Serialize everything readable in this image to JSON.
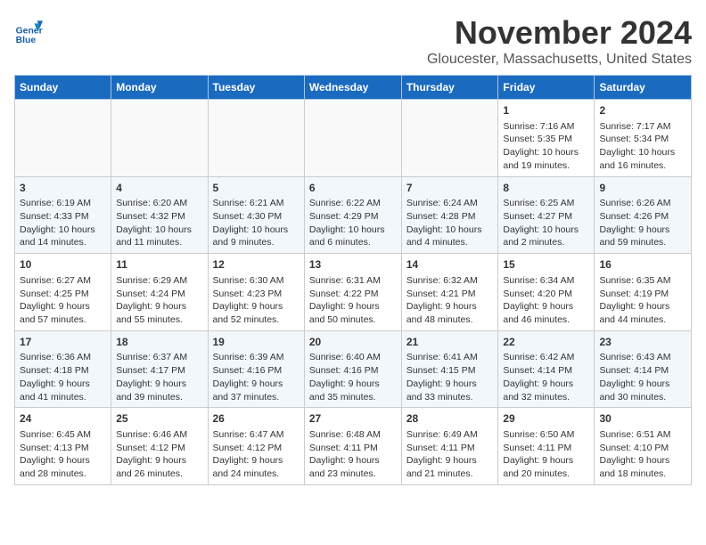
{
  "logo": {
    "line1": "General",
    "line2": "Blue"
  },
  "title": "November 2024",
  "subtitle": "Gloucester, Massachusetts, United States",
  "days_of_week": [
    "Sunday",
    "Monday",
    "Tuesday",
    "Wednesday",
    "Thursday",
    "Friday",
    "Saturday"
  ],
  "weeks": [
    [
      {
        "day": "",
        "info": ""
      },
      {
        "day": "",
        "info": ""
      },
      {
        "day": "",
        "info": ""
      },
      {
        "day": "",
        "info": ""
      },
      {
        "day": "",
        "info": ""
      },
      {
        "day": "1",
        "info": "Sunrise: 7:16 AM\nSunset: 5:35 PM\nDaylight: 10 hours and 19 minutes."
      },
      {
        "day": "2",
        "info": "Sunrise: 7:17 AM\nSunset: 5:34 PM\nDaylight: 10 hours and 16 minutes."
      }
    ],
    [
      {
        "day": "3",
        "info": "Sunrise: 6:19 AM\nSunset: 4:33 PM\nDaylight: 10 hours and 14 minutes."
      },
      {
        "day": "4",
        "info": "Sunrise: 6:20 AM\nSunset: 4:32 PM\nDaylight: 10 hours and 11 minutes."
      },
      {
        "day": "5",
        "info": "Sunrise: 6:21 AM\nSunset: 4:30 PM\nDaylight: 10 hours and 9 minutes."
      },
      {
        "day": "6",
        "info": "Sunrise: 6:22 AM\nSunset: 4:29 PM\nDaylight: 10 hours and 6 minutes."
      },
      {
        "day": "7",
        "info": "Sunrise: 6:24 AM\nSunset: 4:28 PM\nDaylight: 10 hours and 4 minutes."
      },
      {
        "day": "8",
        "info": "Sunrise: 6:25 AM\nSunset: 4:27 PM\nDaylight: 10 hours and 2 minutes."
      },
      {
        "day": "9",
        "info": "Sunrise: 6:26 AM\nSunset: 4:26 PM\nDaylight: 9 hours and 59 minutes."
      }
    ],
    [
      {
        "day": "10",
        "info": "Sunrise: 6:27 AM\nSunset: 4:25 PM\nDaylight: 9 hours and 57 minutes."
      },
      {
        "day": "11",
        "info": "Sunrise: 6:29 AM\nSunset: 4:24 PM\nDaylight: 9 hours and 55 minutes."
      },
      {
        "day": "12",
        "info": "Sunrise: 6:30 AM\nSunset: 4:23 PM\nDaylight: 9 hours and 52 minutes."
      },
      {
        "day": "13",
        "info": "Sunrise: 6:31 AM\nSunset: 4:22 PM\nDaylight: 9 hours and 50 minutes."
      },
      {
        "day": "14",
        "info": "Sunrise: 6:32 AM\nSunset: 4:21 PM\nDaylight: 9 hours and 48 minutes."
      },
      {
        "day": "15",
        "info": "Sunrise: 6:34 AM\nSunset: 4:20 PM\nDaylight: 9 hours and 46 minutes."
      },
      {
        "day": "16",
        "info": "Sunrise: 6:35 AM\nSunset: 4:19 PM\nDaylight: 9 hours and 44 minutes."
      }
    ],
    [
      {
        "day": "17",
        "info": "Sunrise: 6:36 AM\nSunset: 4:18 PM\nDaylight: 9 hours and 41 minutes."
      },
      {
        "day": "18",
        "info": "Sunrise: 6:37 AM\nSunset: 4:17 PM\nDaylight: 9 hours and 39 minutes."
      },
      {
        "day": "19",
        "info": "Sunrise: 6:39 AM\nSunset: 4:16 PM\nDaylight: 9 hours and 37 minutes."
      },
      {
        "day": "20",
        "info": "Sunrise: 6:40 AM\nSunset: 4:16 PM\nDaylight: 9 hours and 35 minutes."
      },
      {
        "day": "21",
        "info": "Sunrise: 6:41 AM\nSunset: 4:15 PM\nDaylight: 9 hours and 33 minutes."
      },
      {
        "day": "22",
        "info": "Sunrise: 6:42 AM\nSunset: 4:14 PM\nDaylight: 9 hours and 32 minutes."
      },
      {
        "day": "23",
        "info": "Sunrise: 6:43 AM\nSunset: 4:14 PM\nDaylight: 9 hours and 30 minutes."
      }
    ],
    [
      {
        "day": "24",
        "info": "Sunrise: 6:45 AM\nSunset: 4:13 PM\nDaylight: 9 hours and 28 minutes."
      },
      {
        "day": "25",
        "info": "Sunrise: 6:46 AM\nSunset: 4:12 PM\nDaylight: 9 hours and 26 minutes."
      },
      {
        "day": "26",
        "info": "Sunrise: 6:47 AM\nSunset: 4:12 PM\nDaylight: 9 hours and 24 minutes."
      },
      {
        "day": "27",
        "info": "Sunrise: 6:48 AM\nSunset: 4:11 PM\nDaylight: 9 hours and 23 minutes."
      },
      {
        "day": "28",
        "info": "Sunrise: 6:49 AM\nSunset: 4:11 PM\nDaylight: 9 hours and 21 minutes."
      },
      {
        "day": "29",
        "info": "Sunrise: 6:50 AM\nSunset: 4:11 PM\nDaylight: 9 hours and 20 minutes."
      },
      {
        "day": "30",
        "info": "Sunrise: 6:51 AM\nSunset: 4:10 PM\nDaylight: 9 hours and 18 minutes."
      }
    ]
  ]
}
